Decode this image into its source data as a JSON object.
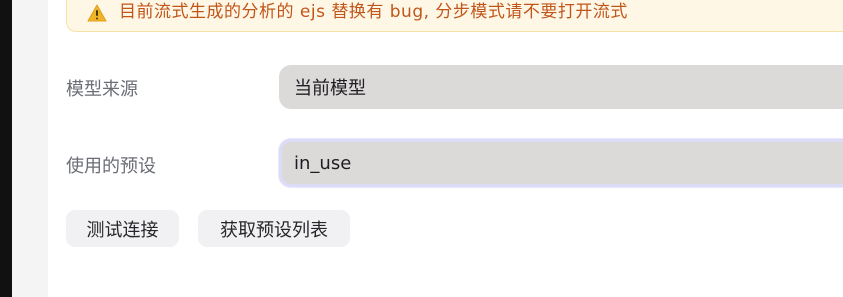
{
  "warning": {
    "icon": "warning-triangle-icon",
    "text": "目前流式生成的分析的 ejs 替换有 bug, 分步模式请不要打开流式"
  },
  "form": {
    "model_source": {
      "label": "模型来源",
      "value": "当前模型"
    },
    "preset": {
      "label": "使用的预设",
      "value": "in_use"
    }
  },
  "actions": {
    "test_connection": "测试连接",
    "fetch_presets": "获取预设列表"
  },
  "colors": {
    "warning_bg": "#fef7e6",
    "warning_text": "#c1561b",
    "field_bg": "#dcd9d9",
    "focus_ring": "#dcdcf7"
  }
}
